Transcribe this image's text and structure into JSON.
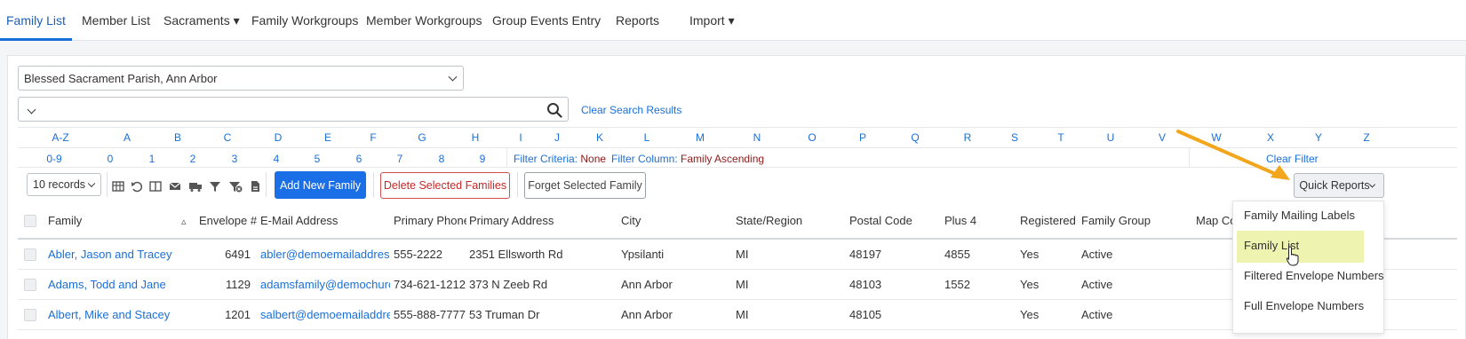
{
  "nav": {
    "tabs": [
      {
        "label": "Family List"
      },
      {
        "label": "Member List"
      },
      {
        "label": "Sacraments ▾"
      },
      {
        "label": "Family Workgroups"
      },
      {
        "label": "Member Workgroups"
      },
      {
        "label": "Group Events Entry"
      },
      {
        "label": "Reports"
      },
      {
        "label": "Import ▾"
      }
    ]
  },
  "parish_select": {
    "value": "Blessed Sacrament Parish, Ann Arbor"
  },
  "search": {
    "value": "",
    "clear_label": "Clear Search Results"
  },
  "alpha_filter": {
    "letters": [
      "A-Z",
      "A",
      "B",
      "C",
      "D",
      "E",
      "F",
      "G",
      "H",
      "I",
      "J",
      "K",
      "L",
      "M",
      "N",
      "O",
      "P",
      "Q",
      "R",
      "S",
      "T",
      "U",
      "V",
      "W",
      "X",
      "Y",
      "Z"
    ],
    "digits": [
      "0-9",
      "0",
      "1",
      "2",
      "3",
      "4",
      "5",
      "6",
      "7",
      "8",
      "9"
    ]
  },
  "filter_info": {
    "criteria_label": "Filter Criteria:",
    "criteria_value": "None",
    "column_label": "Filter Column:",
    "column_value": "Family Ascending",
    "clear_filter": "Clear Filter"
  },
  "toolbar": {
    "records_select": "10 records",
    "add_label": "Add New Family",
    "delete_label": "Delete Selected Families",
    "forget_label": "Forget Selected Family",
    "quick_reports_label": "Quick Reports",
    "icons": [
      "table-icon",
      "undo-icon",
      "columns-icon",
      "email-icon",
      "mail-truck-icon",
      "filter-icon",
      "filter-clear-icon",
      "export-icon"
    ]
  },
  "table": {
    "columns": [
      "Family",
      "Envelope #",
      "E-Mail Address",
      "Primary Phone",
      "Primary Address",
      "City",
      "State/Region",
      "Postal Code",
      "Plus 4",
      "Registered",
      "Family Group",
      "Map Co"
    ],
    "sort_indicator": "▵",
    "rows": [
      {
        "family": "Abler, Jason and Tracey",
        "envelope": "6491",
        "email": "abler@demoemailaddress.com",
        "phone": "555-2222",
        "address": "2351 Ellsworth Rd",
        "city": "Ypsilanti",
        "state": "MI",
        "postal": "48197",
        "plus4": "4855",
        "registered": "Yes",
        "group": "Active"
      },
      {
        "family": "Adams, Todd and Jane",
        "envelope": "1129",
        "email": "adamsfamily@demochurch.org",
        "phone": "734-621-1212",
        "address": "373 N Zeeb Rd",
        "city": "Ann Arbor",
        "state": "MI",
        "postal": "48103",
        "plus4": "1552",
        "registered": "Yes",
        "group": "Active"
      },
      {
        "family": "Albert, Mike and Stacey",
        "envelope": "1201",
        "email": "salbert@demoemailaddress.com",
        "phone": "555-888-7777",
        "address": "53 Truman Dr",
        "city": "Ann Arbor",
        "state": "MI",
        "postal": "48105",
        "plus4": "",
        "registered": "Yes",
        "group": "Active"
      }
    ]
  },
  "quick_reports_menu": {
    "items": [
      {
        "label": "Family Mailing Labels"
      },
      {
        "label": "Family List"
      },
      {
        "label": "Filtered Envelope Numbers"
      },
      {
        "label": "Full Envelope Numbers"
      }
    ],
    "highlighted_index": 1,
    "highlight_color": "#eef3b0"
  },
  "colors": {
    "accent": "#1a6fd6",
    "danger": "#c62828",
    "filter_value": "#8b1a1a",
    "annotation_arrow": "#f2a61c"
  }
}
